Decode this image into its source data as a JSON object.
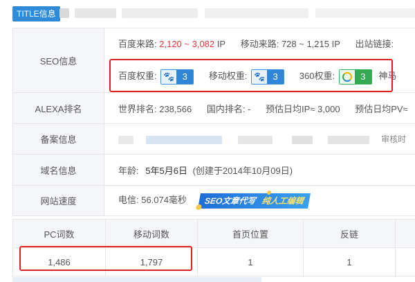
{
  "header": {
    "title_tag": "TITLE信息"
  },
  "seo": {
    "label": "SEO信息",
    "baidu_source_label": "百度来路:",
    "baidu_source_value": "2,120 ~ 3,082",
    "baidu_source_unit": "IP",
    "mobile_source_label": "移动来路:",
    "mobile_source_value": "728 ~ 1,215 IP",
    "outlinks_label": "出站链接:",
    "baidu_weight_label": "百度权重:",
    "baidu_weight": "3",
    "mobile_weight_label": "移动权重:",
    "mobile_weight": "3",
    "w360_label": "360权重:",
    "w360": "3",
    "shenma_label": "神马"
  },
  "alexa": {
    "label": "ALEXA排名",
    "world": "世界排名: 238,566",
    "domestic": "国内排名: -",
    "ip": "预估日均IP≈ 3,000",
    "pv": "预估日均PV≈"
  },
  "beian": {
    "label": "备案信息",
    "tail": "审核时"
  },
  "domain": {
    "label": "域名信息",
    "age_label": "年龄:",
    "age_value": "5年5月6日",
    "created": "(创建于2014年10月09日)"
  },
  "speed": {
    "label": "网站速度",
    "telecom": "电信: 56.074毫秒",
    "banner_a": "SEO文章代写",
    "banner_b": "纯人工编辑"
  },
  "stats": {
    "headers": [
      "PC词数",
      "移动词数",
      "首页位置",
      "反链"
    ],
    "values": [
      "1,486",
      "1,797",
      "1",
      "1"
    ]
  },
  "colors": {
    "accent": "#2f8bd8",
    "highlight": "#e0201f",
    "red": "#e5383b",
    "green": "#34a853"
  }
}
